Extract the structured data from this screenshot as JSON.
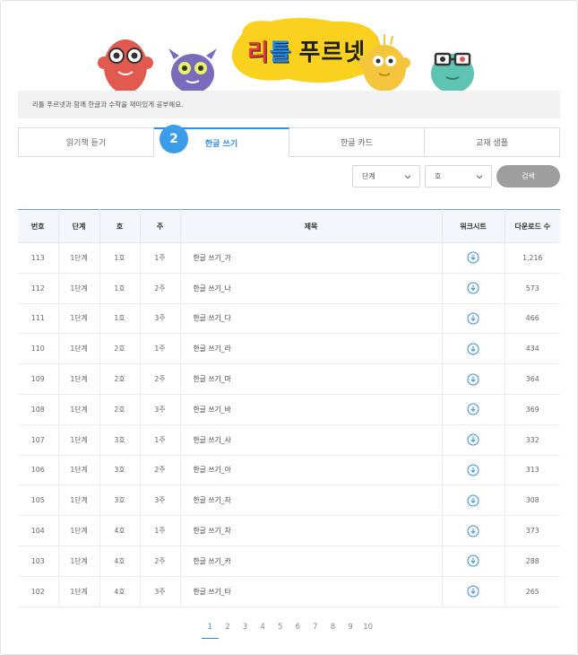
{
  "banner": {
    "logo_char1": "리",
    "logo_char2": "틀",
    "logo_word": "푸르넷"
  },
  "info": {
    "text": "리틀 푸르넷과 함께 한글과 수학을 재미있게 공부해요."
  },
  "step_badge": "2",
  "tabs": [
    {
      "label": "읽기책 듣기",
      "active": false
    },
    {
      "label": "한글 쓰기",
      "active": true
    },
    {
      "label": "한글 카드",
      "active": false
    },
    {
      "label": "교재 샘플",
      "active": false
    }
  ],
  "filters": {
    "level_value": "단계",
    "volume_value": "호",
    "search_label": "검색"
  },
  "table": {
    "headers": [
      "번호",
      "단계",
      "호",
      "주",
      "제목",
      "워크시트",
      "다운로드 수"
    ],
    "rows": [
      {
        "no": "113",
        "level": "1단계",
        "vol": "1호",
        "week": "1주",
        "title": "한글 쓰기_가",
        "downloads": "1,216"
      },
      {
        "no": "112",
        "level": "1단계",
        "vol": "1호",
        "week": "2주",
        "title": "한글 쓰기_나",
        "downloads": "573"
      },
      {
        "no": "111",
        "level": "1단계",
        "vol": "1호",
        "week": "3주",
        "title": "한글 쓰기_다",
        "downloads": "466"
      },
      {
        "no": "110",
        "level": "1단계",
        "vol": "2호",
        "week": "1주",
        "title": "한글 쓰기_라",
        "downloads": "434"
      },
      {
        "no": "109",
        "level": "1단계",
        "vol": "2호",
        "week": "2주",
        "title": "한글 쓰기_마",
        "downloads": "364"
      },
      {
        "no": "108",
        "level": "1단계",
        "vol": "2호",
        "week": "3주",
        "title": "한글 쓰기_바",
        "downloads": "369"
      },
      {
        "no": "107",
        "level": "1단계",
        "vol": "3호",
        "week": "1주",
        "title": "한글 쓰기_사",
        "downloads": "332"
      },
      {
        "no": "106",
        "level": "1단계",
        "vol": "3호",
        "week": "2주",
        "title": "한글 쓰기_아",
        "downloads": "313"
      },
      {
        "no": "105",
        "level": "1단계",
        "vol": "3호",
        "week": "3주",
        "title": "한글 쓰기_자",
        "downloads": "308"
      },
      {
        "no": "104",
        "level": "1단계",
        "vol": "4호",
        "week": "1주",
        "title": "한글 쓰기_차",
        "downloads": "373"
      },
      {
        "no": "103",
        "level": "1단계",
        "vol": "4호",
        "week": "2주",
        "title": "한글 쓰기_카",
        "downloads": "288"
      },
      {
        "no": "102",
        "level": "1단계",
        "vol": "4호",
        "week": "3주",
        "title": "한글 쓰기_타",
        "downloads": "265"
      }
    ]
  },
  "pagination": {
    "pages": [
      "1",
      "2",
      "3",
      "4",
      "5",
      "6",
      "7",
      "8",
      "9",
      "10"
    ],
    "current": "1"
  },
  "colors": {
    "accent": "#2f8de4",
    "badge": "#3b9ce9",
    "header_bg": "#f3f7fc"
  }
}
